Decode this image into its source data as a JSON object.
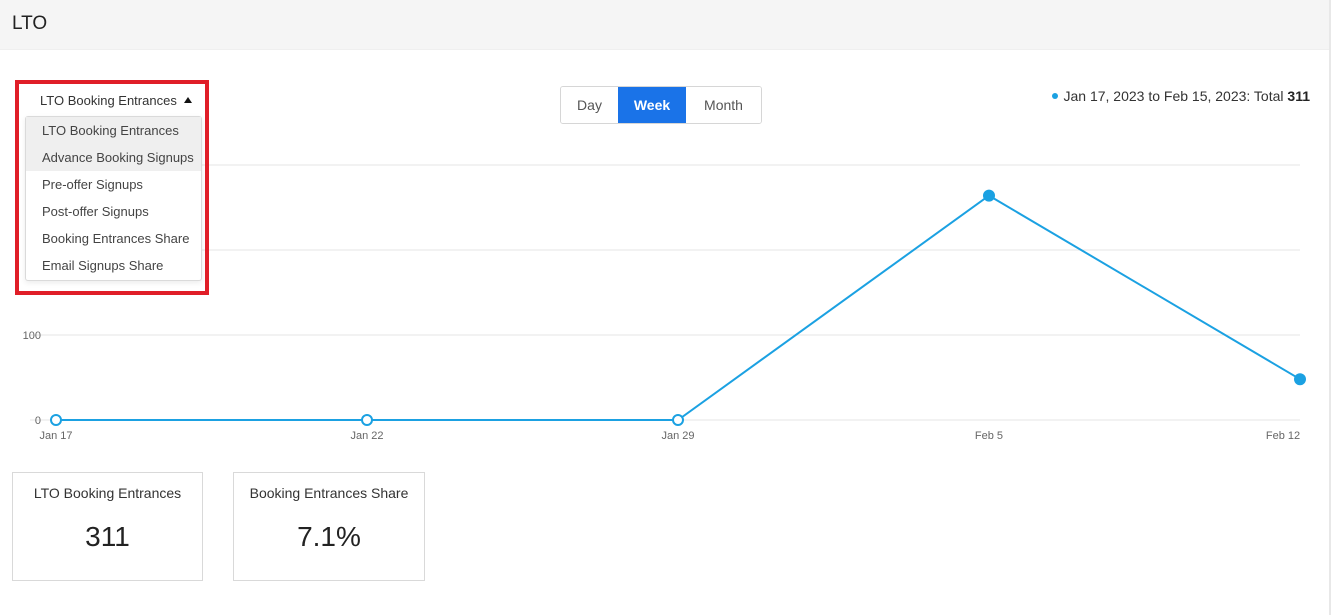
{
  "header": {
    "title": "LTO"
  },
  "metric_dropdown": {
    "selected": "LTO Booking Entrances",
    "options": [
      "LTO Booking Entrances",
      "Advance Booking Signups",
      "Pre-offer Signups",
      "Post-offer Signups",
      "Booking Entrances Share",
      "Email Signups Share"
    ]
  },
  "granularity": {
    "options": [
      "Day",
      "Week",
      "Month"
    ],
    "selected": "Week"
  },
  "legend": {
    "range_text": "Jan 17, 2023 to Feb 15, 2023: Total ",
    "total": "311",
    "color": "#1ba1e2"
  },
  "chart_data": {
    "type": "line",
    "categories": [
      "Jan 17",
      "Jan 22",
      "Jan 29",
      "Feb 5",
      "Feb 12"
    ],
    "series": [
      {
        "values": [
          0,
          0,
          0,
          264,
          48
        ]
      }
    ],
    "y_ticks": [
      "0",
      "100"
    ],
    "ylim": [
      0,
      300
    ],
    "grid": true,
    "line_color": "#1ba1e2"
  },
  "cards": [
    {
      "label": "LTO Booking Entrances",
      "value": "311"
    },
    {
      "label": "Booking Entrances Share",
      "value": "7.1%"
    }
  ]
}
